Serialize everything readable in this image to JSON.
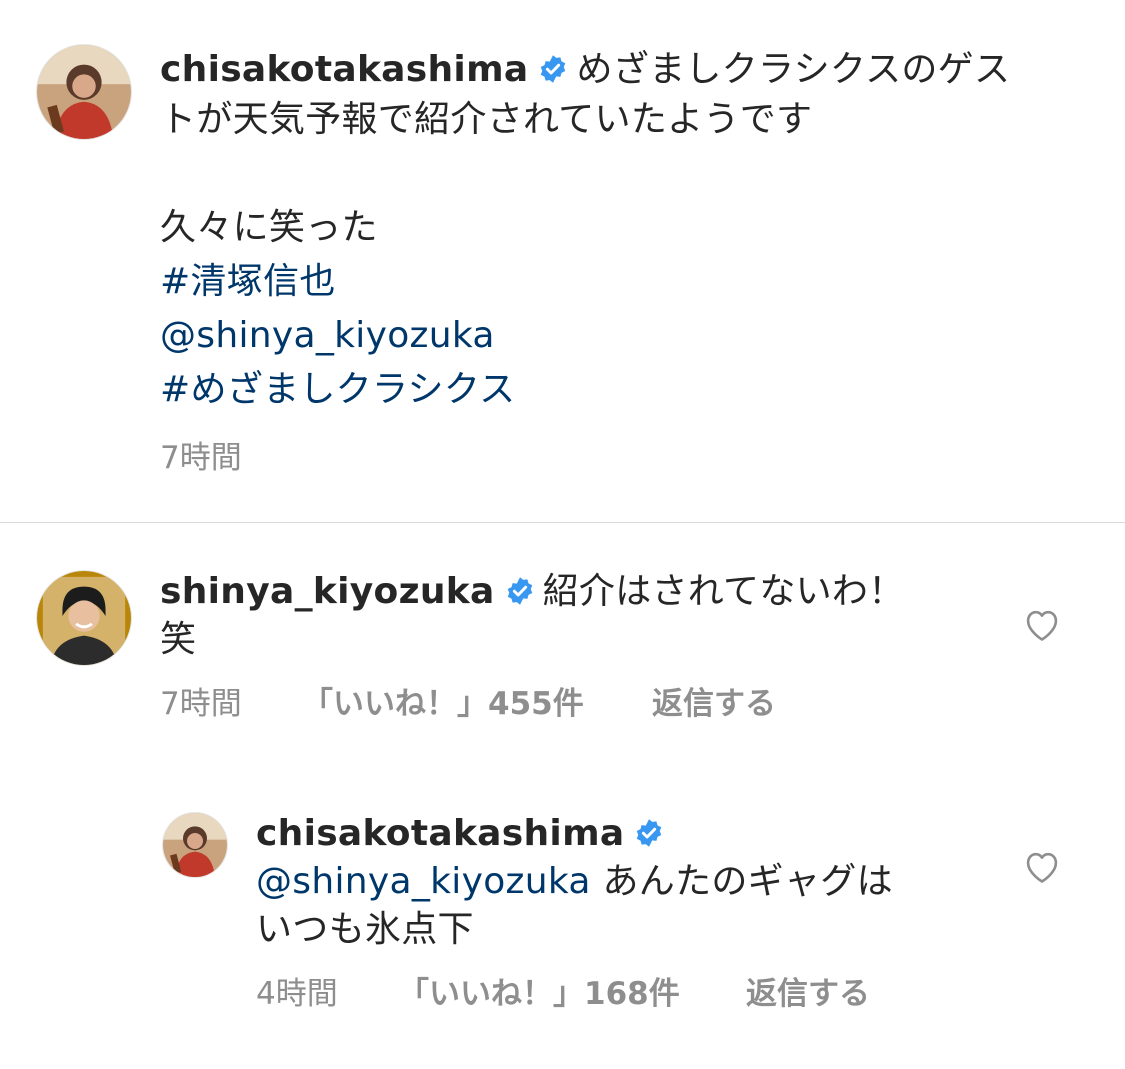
{
  "caption": {
    "username": "chisakotakashima",
    "text_line1": "めざましクラシクスのゲス",
    "text_line2": "トが天気予報で紹介されていたようです",
    "text_line3": "久々に笑った",
    "hashtag1": "#清塚信也",
    "mention": "@shinya_kiyozuka",
    "hashtag2": "#めざましクラシクス",
    "time": "7時間"
  },
  "comment": {
    "username": "shinya_kiyozuka",
    "text_line1": "紹介はされてないわ！",
    "text_line2": "笑",
    "time": "7時間",
    "likes": "「いいね！」455件",
    "reply_label": "返信する"
  },
  "reply": {
    "username": "chisakotakashima",
    "mention": "@shinya_kiyozuka",
    "text_line1": "あんたのギャグは",
    "text_line2": "いつも氷点下",
    "time": "4時間",
    "likes": "「いいね！」168件",
    "reply_label": "返信する"
  },
  "icons": {
    "verified": "verified-badge-icon",
    "heart": "heart-outline-icon"
  },
  "colors": {
    "verified_blue": "#3897f0",
    "link_blue": "#00376b",
    "meta_gray": "#8e8e8e",
    "text": "#262626"
  }
}
